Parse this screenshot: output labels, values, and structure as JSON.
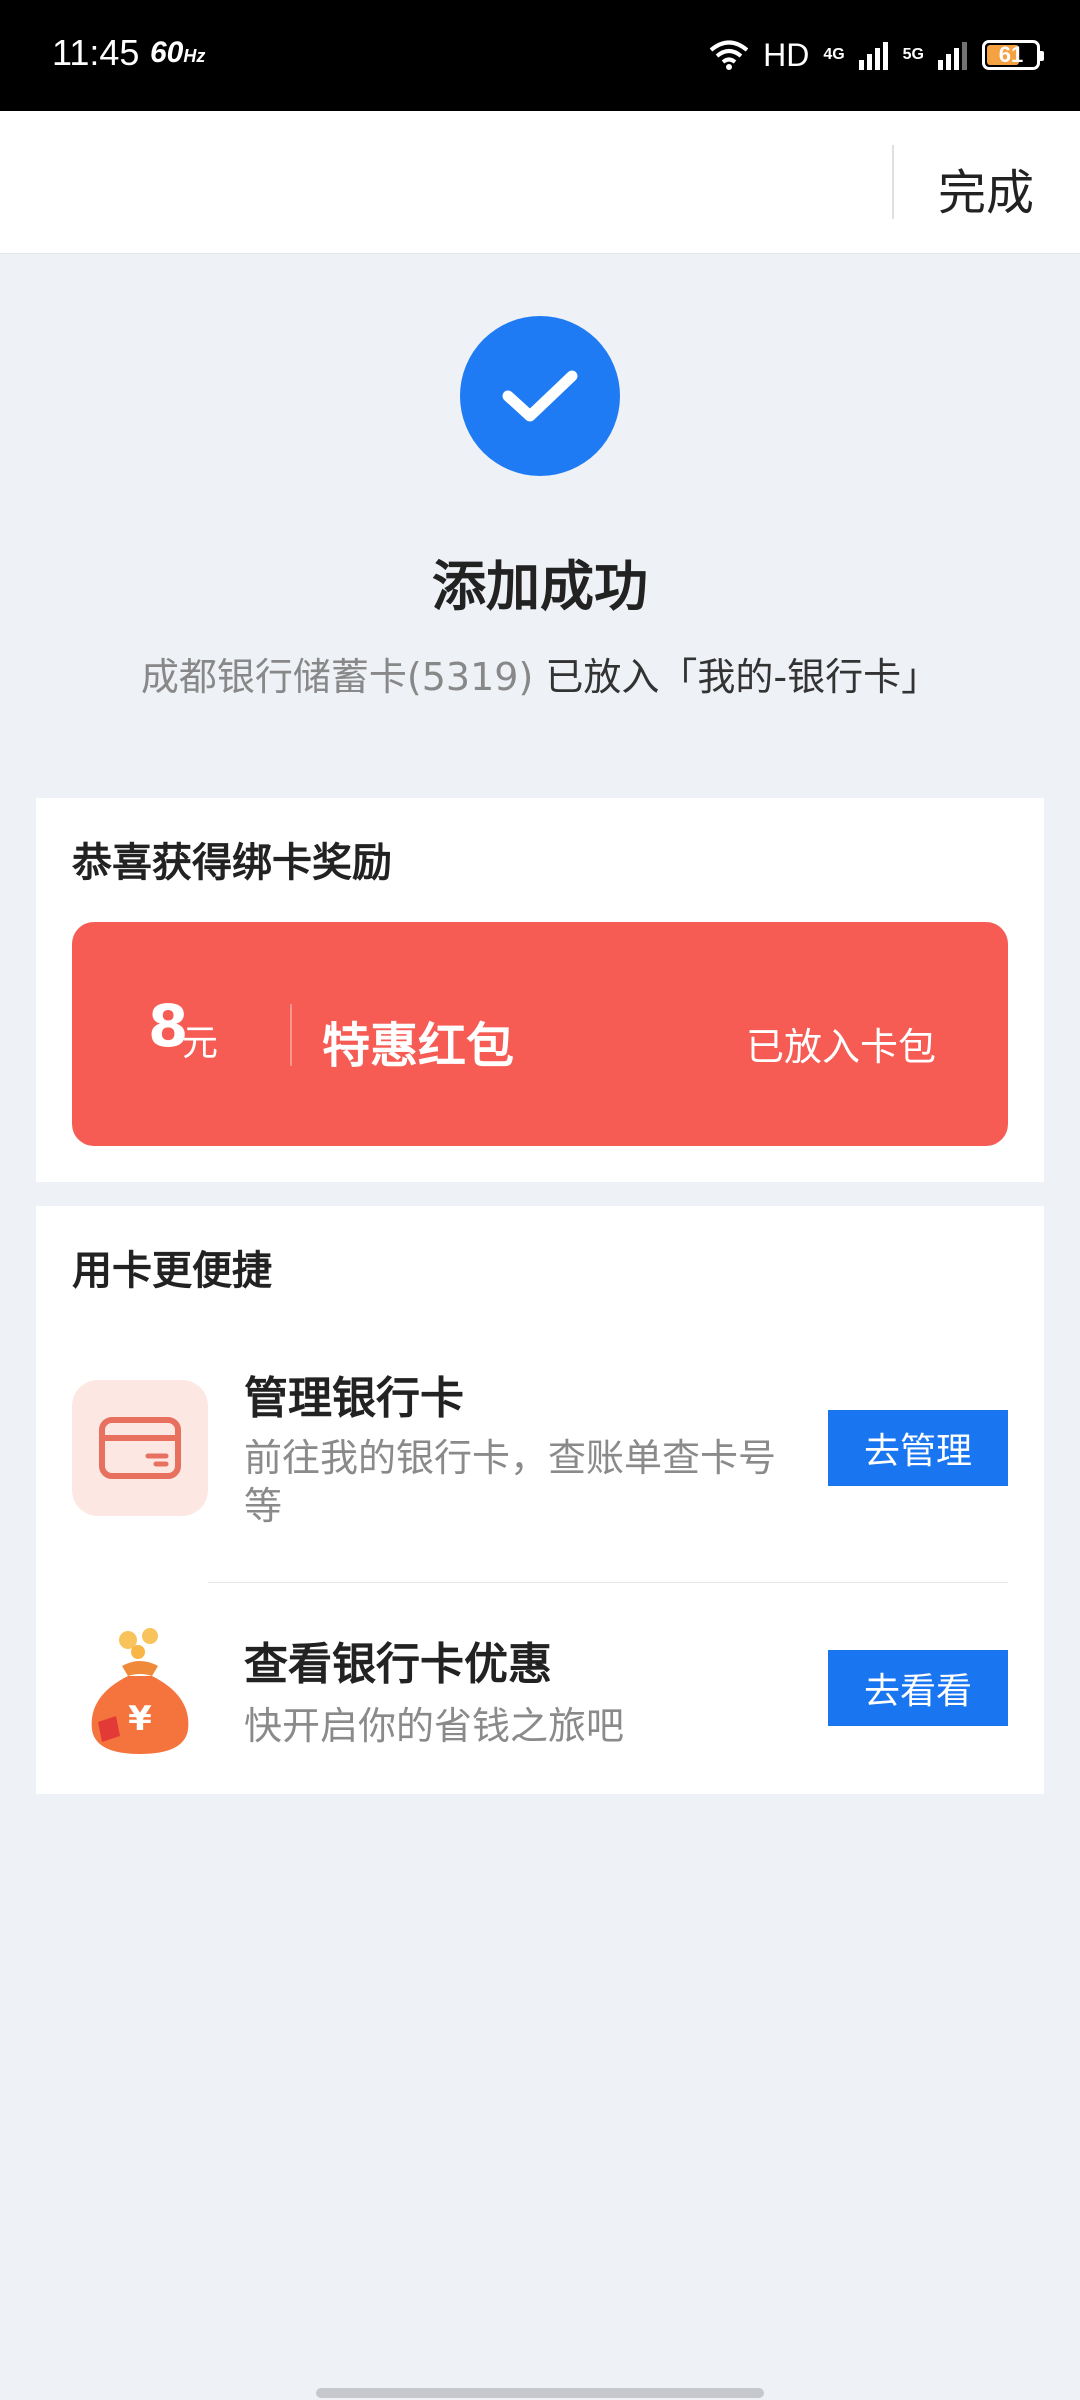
{
  "status_bar": {
    "time": "11:45",
    "refresh_rate": "60",
    "refresh_unit": "Hz",
    "hd": "HD",
    "net1": "4G",
    "net2": "5G",
    "battery": "61"
  },
  "nav": {
    "done_label": "完成"
  },
  "success": {
    "title": "添加成功",
    "card_name": "成都银行储蓄卡(5319)",
    "placed_text": "已放入「我的-银行卡」"
  },
  "reward": {
    "section_title": "恭喜获得绑卡奖励",
    "amount": "8",
    "unit": "元",
    "name": "特惠红包",
    "status": "已放入卡包"
  },
  "use_card": {
    "section_title": "用卡更便捷",
    "items": [
      {
        "icon": "bank-card-icon",
        "title": "管理银行卡",
        "desc": "前往我的银行卡，查账单查卡号等",
        "button": "去管理"
      },
      {
        "icon": "money-bag-icon",
        "title": "查看银行卡优惠",
        "desc": "快开启你的省钱之旅吧",
        "button": "去看看"
      }
    ]
  },
  "colors": {
    "accent_blue": "#1f7bf3",
    "reward_red": "#f65b54",
    "page_bg": "#eef1f6"
  }
}
